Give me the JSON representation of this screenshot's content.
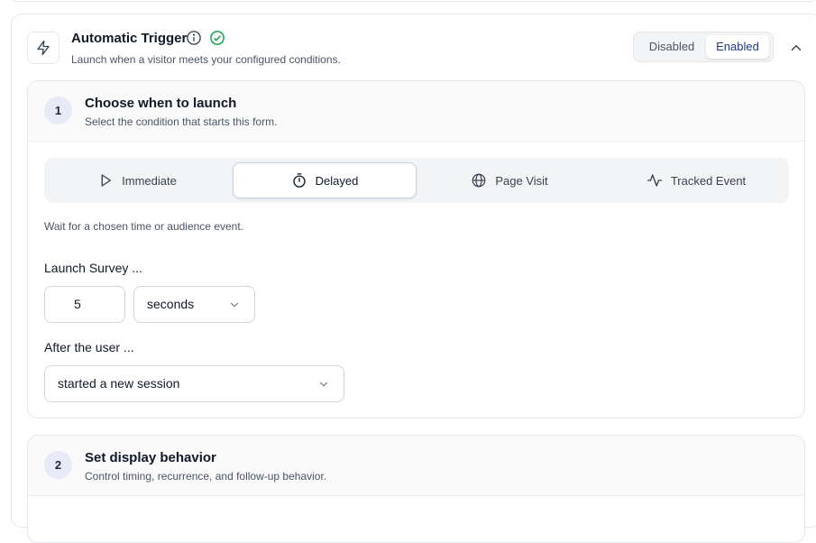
{
  "trigger": {
    "title": "Automatic Trigger",
    "description": "Launch when a visitor meets your configured conditions.",
    "toggle": {
      "disabled_label": "Disabled",
      "enabled_label": "Enabled",
      "selected": "Enabled"
    },
    "icons": {
      "trigger": "lightning-icon",
      "info": "info-icon",
      "status": "check-circle-icon",
      "collapse": "chevron-up-icon"
    },
    "status_color": "#16a34a"
  },
  "step1": {
    "number": "1",
    "title": "Choose when to launch",
    "description": "Select the condition that starts this form.",
    "tabs": [
      {
        "label": "Immediate",
        "icon": "play-icon"
      },
      {
        "label": "Delayed",
        "icon": "timer-icon"
      },
      {
        "label": "Page Visit",
        "icon": "globe-icon"
      },
      {
        "label": "Tracked Event",
        "icon": "activity-icon"
      }
    ],
    "selected_tab": "Delayed",
    "tab_hint": "Wait for a chosen time or audience event.",
    "launch_label": "Launch Survey ...",
    "delay_value": "5",
    "delay_unit": "seconds",
    "after_label": "After the user ...",
    "after_value": "started a new session"
  },
  "step2": {
    "number": "2",
    "title": "Set display behavior",
    "description": "Control timing, recurrence, and follow-up behavior."
  },
  "colors": {
    "accent": "#1e3a8a",
    "step_badge_bg": "#e8eaf7"
  }
}
